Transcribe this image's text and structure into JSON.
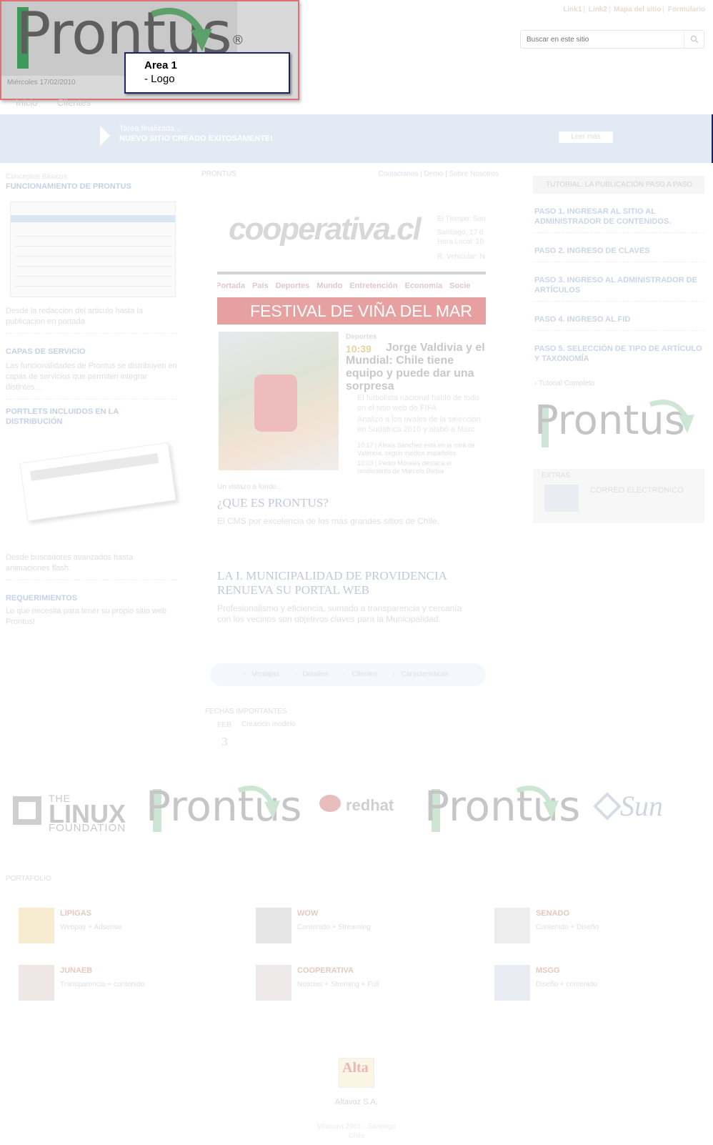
{
  "header": {
    "links": [
      "Link1",
      "Link2",
      "Mapa del sitio",
      "Formulario"
    ],
    "search_placeholder": "Buscar en este sitio",
    "date": "Miércoles 17/02/2010"
  },
  "logo": {
    "text": "Prontus",
    "registered": "®"
  },
  "annotation": {
    "title": "Area 1",
    "description": "- Logo"
  },
  "nav": {
    "items": [
      "Inicio",
      "Clientes"
    ]
  },
  "notice": {
    "subtitle": "Tarea finalizada...",
    "message": "NUEVO SITIO CREADO EXITOSAMENTE!",
    "button": "Leer más"
  },
  "left": {
    "kicker": "Conceptos Básicos",
    "sections": [
      {
        "title": "FUNCIONAMIENTO DE PRONTUS",
        "text": "Desde la redaccion del articulo hasta la publicacion en portada"
      },
      {
        "title": "CAPAS DE SERVICIO",
        "text": "Las funcionalidades de Prontus se distribuyen en capas de servicios que permiten integrar distintes..."
      },
      {
        "title": "PORTLETS INCLUIDOS EN LA DISTRIBUCIÓN",
        "text": "Desde buscadores avanzados hasta animaciones flash."
      },
      {
        "title": "REQUERIMIENTOS",
        "text": "Lo que necesita para tener su propio sitio web Prontus!"
      }
    ]
  },
  "center": {
    "head": "PRONTUS",
    "links": [
      "Contactanos",
      "Demo",
      "Sobre Nosotros"
    ],
    "screenshot": {
      "logo": "cooperativa.cl",
      "weather": [
        "El Tiempo: San",
        "Santiago, 17 d",
        "Hora Local: 10",
        "R. Vehicular: N"
      ],
      "menu": [
        "Portada",
        "País",
        "Deportes",
        "Mundo",
        "Entretención",
        "Economía",
        "Socie"
      ],
      "banner": "FESTIVAL DE VIÑA DEL MAR",
      "section": "Deportes",
      "time": "10:39",
      "headline": "Jorge Valdivia y el Mundial: Chile tiene equipo y puede dar una sorpresa",
      "bullets": [
        "El futbolista nacional habló de todo en el sitio web de FIFA",
        "Analizó a los rivales de la selección en Sudáfrica 2010 y alabó a Marc"
      ],
      "minor": [
        "10:17 | Alexis Sánchez está en la mira de Valencia, según medios españoles",
        "10:03 | Pedro Morales destaca el rendimiento de Marcelo Bielsa"
      ]
    },
    "vistazo": "Un vistazo a fondo...",
    "article1": {
      "title": "¿QUE ES PRONTUS?",
      "text": "El CMS por excelencia de los mas grandes sitios de Chile."
    },
    "article2": {
      "title": "LA I. MUNICIPALIDAD DE PROVIDENCIA RENUEVA SU PORTAL WEB",
      "text": "Profesionalismo y eficiencia, sumado a transparencia y cercanía con los vecinos son objetivos claves para la Municipalidad."
    },
    "tabs": [
      "Ventajas",
      "Detalles",
      "Clientes",
      "Caracteristicas"
    ],
    "fechas": {
      "title": "FECHAS IMPORTANTES",
      "month": "FEB",
      "day": "3",
      "label": "Creación modelo"
    }
  },
  "right": {
    "head": "TUTORIAL: LA PUBLICACIÓN PASO A PASO",
    "steps": [
      "PASO 1. INGRESAR AL SITIO AL ADMINISTRADOR DE CONTENIDOS.",
      "PASO 2. INGRESO DE CLAVES",
      "PASO 3. INGRESO AL ADMINISTRADOR DE ARTÍCULOS",
      "PASO 4. INGRESO AL FID",
      "PASO 5. SELECCIÓN DE TIPO DE ARTÍCULO Y TAXONOMÍA"
    ],
    "tutorial_link": "Tutorial Completo",
    "logo_text": "Prontus",
    "extras_title": "EXTRAS",
    "extras_item": "CORREO ELECTRONICO"
  },
  "sponsors": {
    "linux": [
      "THE",
      "LINUX",
      "FOUNDATION"
    ],
    "prontus": "Prontus",
    "redhat": "redhat",
    "sun": "Sun"
  },
  "portafolio": {
    "title": "PORTAFOLIO",
    "items": [
      {
        "name": "LIPIGAS",
        "desc": "Webpay + Adsense"
      },
      {
        "name": "WOW",
        "desc": "Contenido + Streaming"
      },
      {
        "name": "SENADO",
        "desc": "Contenido + Diseño"
      },
      {
        "name": "JUNAEB",
        "desc": "Transparencia + contenido"
      },
      {
        "name": "COOPERATIVA",
        "desc": "Noticias + Streming + Full"
      },
      {
        "name": "MSGG",
        "desc": "Diseño + contenido"
      }
    ]
  },
  "footer": {
    "logo": "Alta",
    "company": "Altavoz S.A.",
    "address": [
      "Vitacura 2961 - Santiago",
      "Chile"
    ]
  }
}
